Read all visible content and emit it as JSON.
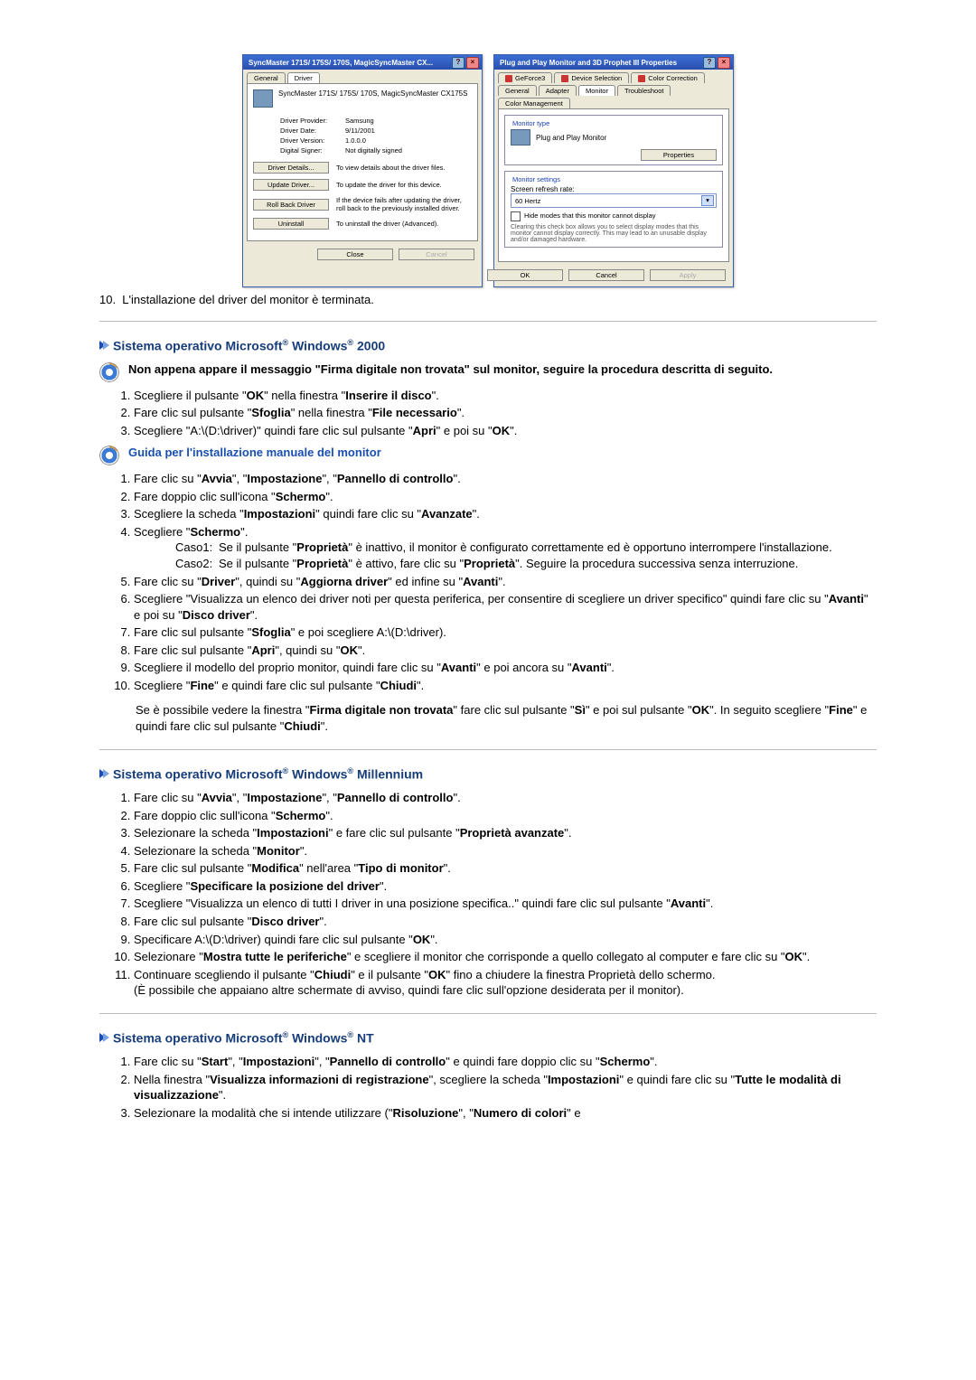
{
  "dlg1": {
    "title": "SyncMaster 171S/ 175S/ 170S, MagicSyncMaster CX...",
    "tab_general": "General",
    "tab_driver": "Driver",
    "device_name": "SyncMaster 171S/ 175S/ 170S, MagicSyncMaster CX175S",
    "kv": {
      "k1": "Driver Provider:",
      "v1": "Samsung",
      "k2": "Driver Date:",
      "v2": "9/11/2001",
      "k3": "Driver Version:",
      "v3": "1.0.0.0",
      "k4": "Digital Signer:",
      "v4": "Not digitally signed"
    },
    "actions": {
      "b1": "Driver Details...",
      "d1": "To view details about the driver files.",
      "b2": "Update Driver...",
      "d2": "To update the driver for this device.",
      "b3": "Roll Back Driver",
      "d3": "If the device fails after updating the driver, roll back to the previously installed driver.",
      "b4": "Uninstall",
      "d4": "To uninstall the driver (Advanced)."
    },
    "close": "Close",
    "cancel": "Cancel"
  },
  "dlg2": {
    "title": "Plug and Play Monitor and 3D Prophet III Properties",
    "tabs": {
      "a": "GeForce3",
      "b": "Device Selection",
      "c": "Color Correction",
      "d": "General",
      "e": "Adapter",
      "f": "Monitor",
      "g": "Troubleshoot",
      "h": "Color Management"
    },
    "group1": "Monitor type",
    "monitor_name": "Plug and Play Monitor",
    "properties": "Properties",
    "group2": "Monitor settings",
    "refresh_label": "Screen refresh rate:",
    "refresh_value": "60 Hertz",
    "hide_modes": "Hide modes that this monitor cannot display",
    "hide_note": "Clearing this check box allows you to select display modes that this monitor cannot display correctly. This may lead to an unusable display and/or damaged hardware.",
    "ok": "OK",
    "cancel": "Cancel",
    "apply": "Apply"
  },
  "line10": "L'installazione del driver del monitor è terminata.",
  "sec2000": {
    "heading_pre": "Sistema operativo Microsoft",
    "heading_mid": " Windows",
    "heading_post": " 2000",
    "lead": "Non appena appare il messaggio \"Firma digitale non trovata\" sul monitor, seguire la procedura descritta di seguito.",
    "steps_a": {
      "s1a": "Scegliere il pulsante \"",
      "s1b": "OK",
      "s1c": "\" nella finestra \"",
      "s1d": "Inserire il disco",
      "s1e": "\".",
      "s2a": "Fare clic sul pulsante \"",
      "s2b": "Sfoglia",
      "s2c": "\" nella finestra \"",
      "s2d": "File necessario",
      "s2e": "\".",
      "s3a": "Scegliere \"A:\\(D:\\driver)\" quindi fare clic sul pulsante \"",
      "s3b": "Apri",
      "s3c": "\" e poi su \"",
      "s3d": "OK",
      "s3e": "\"."
    },
    "guide": "Guida per l'installazione manuale del monitor",
    "steps_b": {
      "s1a": "Fare clic su \"",
      "s1b": "Avvia",
      "s1c": "\", \"",
      "s1d": "Impostazione",
      "s1e": "\", \"",
      "s1f": "Pannello di controllo",
      "s1g": "\".",
      "s2a": "Fare doppio clic sull'icona \"",
      "s2b": "Schermo",
      "s2c": "\".",
      "s3a": "Scegliere la scheda \"",
      "s3b": "Impostazioni",
      "s3c": "\" quindi fare clic su \"",
      "s3d": "Avanzate",
      "s3e": "\".",
      "s4a": "Scegliere \"",
      "s4b": "Schermo",
      "s4c": "\".",
      "c1l": "Caso1:",
      "c1a": "Se il pulsante \"",
      "c1b": "Proprietà",
      "c1c": "\" è inattivo, il monitor è configurato correttamente ed è opportuno interrompere l'installazione.",
      "c2l": "Caso2:",
      "c2a": "Se il pulsante \"",
      "c2b": "Proprietà",
      "c2c": "\" è attivo, fare clic su \"",
      "c2d": "Proprietà",
      "c2e": "\". Seguire la procedura successiva senza interruzione.",
      "s5a": "Fare clic su \"",
      "s5b": "Driver",
      "s5c": "\", quindi su \"",
      "s5d": "Aggiorna driver",
      "s5e": "\" ed infine su \"",
      "s5f": "Avanti",
      "s5g": "\".",
      "s6a": "Scegliere \"Visualizza un elenco dei driver noti per questa periferica, per consentire di scegliere un driver specifico\" quindi fare clic su \"",
      "s6b": "Avanti",
      "s6c": "\" e poi su \"",
      "s6d": "Disco driver",
      "s6e": "\".",
      "s7a": "Fare clic sul pulsante \"",
      "s7b": "Sfoglia",
      "s7c": "\" e poi scegliere A:\\(D:\\driver).",
      "s8a": "Fare clic sul pulsante \"",
      "s8b": "Apri",
      "s8c": "\", quindi su \"",
      "s8d": "OK",
      "s8e": "\".",
      "s9a": "Scegliere il modello del proprio monitor, quindi fare clic su \"",
      "s9b": "Avanti",
      "s9c": "\" e poi ancora su \"",
      "s9d": "Avanti",
      "s9e": "\".",
      "s10a": "Scegliere \"",
      "s10b": "Fine",
      "s10c": "\" e quindi fare clic sul pulsante \"",
      "s10d": "Chiudi",
      "s10e": "\"."
    },
    "note_a": "Se è possibile vedere la finestra \"",
    "note_b": "Firma digitale non trovata",
    "note_c": "\" fare clic sul pulsante \"",
    "note_d": "Sì",
    "note_e": "\" e poi sul pulsante \"",
    "note_f": "OK",
    "note_g": "\". In seguito scegliere \"",
    "note_h": "Fine",
    "note_i": "\" e quindi fare clic sul pulsante \"",
    "note_j": "Chiudi",
    "note_k": "\"."
  },
  "secME": {
    "heading_pre": "Sistema operativo Microsoft",
    "heading_mid": " Windows",
    "heading_post": " Millennium",
    "s1a": "Fare clic su \"",
    "s1b": "Avvia",
    "s1c": "\", \"",
    "s1d": "Impostazione",
    "s1e": "\", \"",
    "s1f": "Pannello di controllo",
    "s1g": "\".",
    "s2a": "Fare doppio clic sull'icona \"",
    "s2b": "Schermo",
    "s2c": "\".",
    "s3a": "Selezionare la scheda \"",
    "s3b": "Impostazioni",
    "s3c": "\" e fare clic sul pulsante \"",
    "s3d": "Proprietà avanzate",
    "s3e": "\".",
    "s4a": "Selezionare la scheda \"",
    "s4b": "Monitor",
    "s4c": "\".",
    "s5a": "Fare clic sul pulsante \"",
    "s5b": "Modifica",
    "s5c": "\" nell'area \"",
    "s5d": "Tipo di monitor",
    "s5e": "\".",
    "s6a": "Scegliere \"",
    "s6b": "Specificare la posizione del driver",
    "s6c": "\".",
    "s7a": "Scegliere \"Visualizza un elenco di tutti I driver in una posizione specifica..\" quindi fare clic sul pulsante \"",
    "s7b": "Avanti",
    "s7c": "\".",
    "s8a": "Fare clic sul pulsante \"",
    "s8b": "Disco driver",
    "s8c": "\".",
    "s9a": "Specificare A:\\(D:\\driver) quindi fare clic sul pulsante \"",
    "s9b": "OK",
    "s9c": "\".",
    "s10a": "Selezionare \"",
    "s10b": "Mostra tutte le periferiche",
    "s10c": "\" e scegliere il monitor che corrisponde a quello collegato al computer e fare clic su \"",
    "s10d": "OK",
    "s10e": "\".",
    "s11a": "Continuare scegliendo il pulsante \"",
    "s11b": "Chiudi",
    "s11c": "\" e il pulsante \"",
    "s11d": "OK",
    "s11e": "\" fino a chiudere la finestra Proprietà dello schermo.",
    "s11f": "(È possibile che appaiano altre schermate di avviso, quindi fare clic sull'opzione desiderata per il monitor)."
  },
  "secNT": {
    "heading_pre": "Sistema operativo Microsoft",
    "heading_mid": " Windows",
    "heading_post": " NT",
    "s1a": "Fare clic su \"",
    "s1b": "Start",
    "s1c": "\", \"",
    "s1d": "Impostazioni",
    "s1e": "\", \"",
    "s1f": "Pannello di controllo",
    "s1g": "\" e quindi fare doppio clic su \"",
    "s1h": "Schermo",
    "s1i": "\".",
    "s2a": "Nella finestra \"",
    "s2b": "Visualizza informazioni di registrazione",
    "s2c": "\", scegliere la scheda \"",
    "s2d": "Impostazioni",
    "s2e": "\" e quindi fare clic su \"",
    "s2f": "Tutte le modalità di visualizzazione",
    "s2g": "\".",
    "s3a": "Selezionare la modalità che si intende utilizzare (\"",
    "s3b": "Risoluzione",
    "s3c": "\", \"",
    "s3d": "Numero di colori",
    "s3e": "\" e"
  }
}
